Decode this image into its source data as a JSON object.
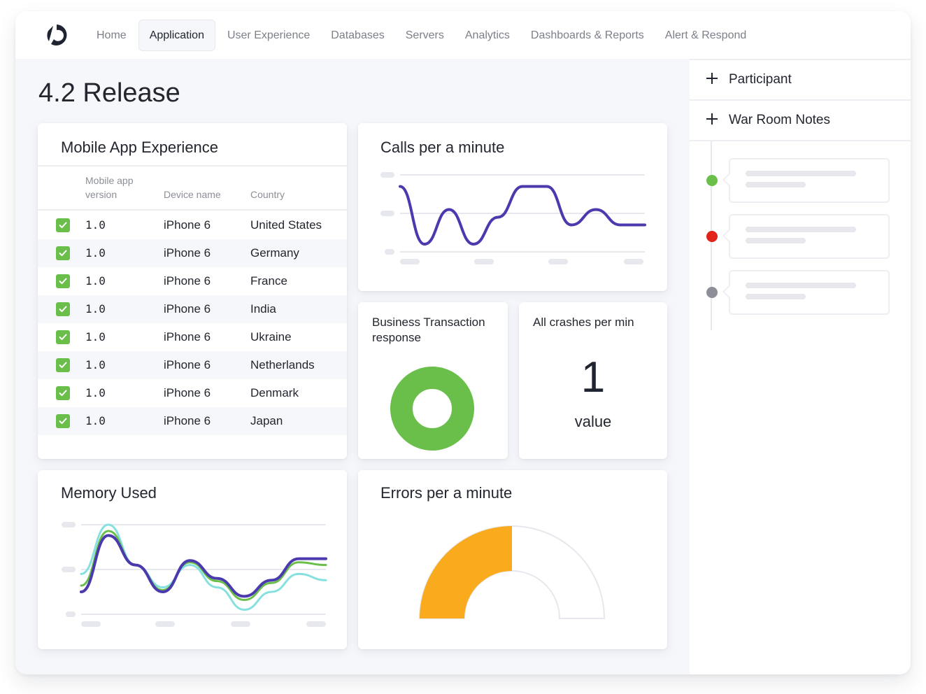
{
  "nav": {
    "items": [
      {
        "label": "Home",
        "active": false
      },
      {
        "label": "Application",
        "active": true
      },
      {
        "label": "User Experience",
        "active": false
      },
      {
        "label": "Databases",
        "active": false
      },
      {
        "label": "Servers",
        "active": false
      },
      {
        "label": "Analytics",
        "active": false
      },
      {
        "label": "Dashboards & Reports",
        "active": false
      },
      {
        "label": "Alert & Respond",
        "active": false
      }
    ]
  },
  "page": {
    "title": "4.2 Release"
  },
  "mobile_app": {
    "title": "Mobile App Experience",
    "columns": [
      "Mobile app version",
      "Device name",
      "Country"
    ],
    "rows": [
      {
        "checked": true,
        "version": "1.0",
        "device": "iPhone 6",
        "country": "United States"
      },
      {
        "checked": true,
        "version": "1.0",
        "device": "iPhone 6",
        "country": "Germany"
      },
      {
        "checked": true,
        "version": "1.0",
        "device": "iPhone 6",
        "country": "France"
      },
      {
        "checked": true,
        "version": "1.0",
        "device": "iPhone 6",
        "country": "India"
      },
      {
        "checked": true,
        "version": "1.0",
        "device": "iPhone 6",
        "country": "Ukraine"
      },
      {
        "checked": true,
        "version": "1.0",
        "device": "iPhone 6",
        "country": "Netherlands"
      },
      {
        "checked": true,
        "version": "1.0",
        "device": "iPhone 6",
        "country": "Denmark"
      },
      {
        "checked": true,
        "version": "1.0",
        "device": "iPhone 6",
        "country": "Japan"
      }
    ]
  },
  "widgets": {
    "calls": {
      "title": "Calls per a minute"
    },
    "business": {
      "title": "Business Transaction response"
    },
    "crashes": {
      "title": "All crashes per min",
      "value": "1",
      "label": "value"
    },
    "memory": {
      "title": "Memory Used"
    },
    "errors": {
      "title": "Errors per a minute"
    }
  },
  "side_panel": {
    "participant_label": "Participant",
    "notes_label": "War Room Notes",
    "timeline": [
      {
        "status": "success",
        "color": "#6abf4b"
      },
      {
        "status": "error",
        "color": "#e2231a"
      },
      {
        "status": "neutral",
        "color": "#8c8f98"
      }
    ]
  },
  "colors": {
    "accent_purple": "#4b3aad",
    "green": "#6abf4b",
    "teal": "#86e0e0",
    "orange": "#f9aa1d",
    "gridline": "#e7e8ee"
  },
  "chart_data": [
    {
      "type": "line",
      "title": "Calls per a minute",
      "x": [
        0,
        1,
        2,
        3,
        4,
        5,
        6,
        7,
        8,
        9,
        10
      ],
      "series": [
        {
          "name": "calls",
          "values": [
            0.85,
            0.1,
            0.55,
            0.1,
            0.45,
            0.85,
            0.85,
            0.35,
            0.55,
            0.35,
            0.35
          ]
        }
      ],
      "ylim": [
        0,
        1
      ],
      "grid": true,
      "tick_labels_hidden": true
    },
    {
      "type": "pie",
      "title": "Business Transaction response",
      "values": [
        100
      ],
      "donut": true
    },
    {
      "type": "line",
      "title": "Memory Used",
      "x": [
        0,
        1,
        2,
        3,
        4,
        5,
        6,
        7,
        8,
        9
      ],
      "series": [
        {
          "name": "series-purple",
          "values": [
            0.25,
            0.88,
            0.55,
            0.25,
            0.6,
            0.4,
            0.2,
            0.38,
            0.62,
            0.62
          ]
        },
        {
          "name": "series-green",
          "values": [
            0.32,
            0.93,
            0.55,
            0.27,
            0.58,
            0.37,
            0.16,
            0.35,
            0.58,
            0.55
          ]
        },
        {
          "name": "series-teal",
          "values": [
            0.45,
            1.0,
            0.55,
            0.3,
            0.55,
            0.3,
            0.05,
            0.25,
            0.45,
            0.38
          ]
        }
      ],
      "ylim": [
        0,
        1
      ],
      "grid": true,
      "tick_labels_hidden": true
    },
    {
      "type": "pie",
      "title": "Errors per a minute",
      "gauge": true,
      "value_fraction": 0.5
    }
  ]
}
